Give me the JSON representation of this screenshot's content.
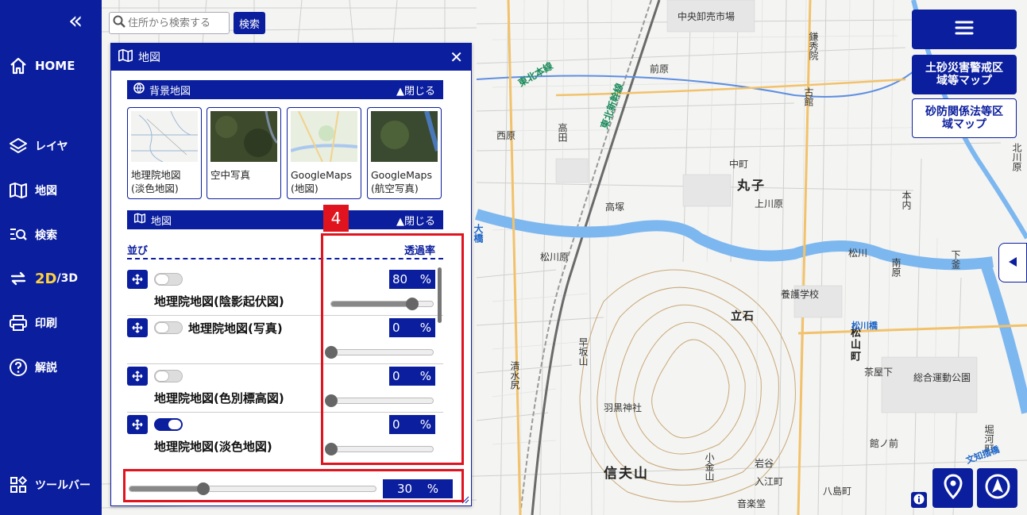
{
  "colors": {
    "primary": "#0b1e9e",
    "accent_2d": "#ffd23c",
    "highlight": "#e0141e"
  },
  "sidebar": {
    "collapse_icon": "double-chevron-left-icon",
    "items": [
      {
        "label": "HOME",
        "icon": "home-icon"
      },
      {
        "label": "レイヤ",
        "icon": "layers-icon"
      },
      {
        "label": "地図",
        "icon": "map-icon"
      },
      {
        "label": "検索",
        "icon": "search-list-icon"
      },
      {
        "label_2d": "2D",
        "label_3d": "/3D",
        "icon": "swap-icon"
      },
      {
        "label": "印刷",
        "icon": "printer-icon"
      },
      {
        "label": "解説",
        "icon": "help-icon"
      },
      {
        "label": "ツールバー",
        "icon": "grid-icon"
      }
    ]
  },
  "search": {
    "placeholder": "住所から検索する",
    "button": "検索"
  },
  "panel": {
    "title": "地図",
    "basemap_section": {
      "title": "背景地図",
      "toggle": "▲閉じる",
      "items": [
        {
          "name": "地理院地図\n(淡色地図)"
        },
        {
          "name": "空中写真"
        },
        {
          "name": "GoogleMaps\n(地図)"
        },
        {
          "name": "GoogleMaps\n(航空写真)"
        }
      ]
    },
    "map_section": {
      "title": "地図",
      "toggle": "▲閉じる",
      "col_order": "並び",
      "col_opacity": "透過率",
      "layers": [
        {
          "name": "地理院地図(陰影起伏図)",
          "enabled": false,
          "opacity": "80",
          "opacity_value": 80,
          "unit": "%"
        },
        {
          "name": "地理院地図(写真)",
          "enabled": false,
          "opacity": "0",
          "opacity_value": 0,
          "unit": "%"
        },
        {
          "name": "地理院地図(色別標高図)",
          "enabled": false,
          "opacity": "0",
          "opacity_value": 0,
          "unit": "%"
        },
        {
          "name": "地理院地図(淡色地図)",
          "enabled": true,
          "opacity": "0",
          "opacity_value": 0,
          "unit": "%"
        }
      ]
    },
    "overall_opacity": {
      "value": "30",
      "value_num": 30,
      "unit": "%"
    }
  },
  "annotation_badge": "4",
  "right_panel": {
    "menu_icon": "hamburger-icon",
    "btn_landslide": "土砂災害警戒区\n域等マップ",
    "btn_sabo": "砂防関係法等区\n域マップ",
    "side_tab_icon": "triangle-left-icon",
    "info_icon": "info-icon",
    "location_icon": "location-pin-icon",
    "compass_icon": "north-arrow-icon"
  },
  "map_labels": [
    "中央卸売市場",
    "鎌秀院",
    "古館",
    "前原",
    "高田",
    "東北本線",
    "東北新幹線",
    "西原",
    "中町",
    "丸子",
    "上川原",
    "高塚",
    "松川原",
    "大橋",
    "養護学校",
    "立石",
    "松山町",
    "茶屋下",
    "総合運動公園",
    "羽黒神社",
    "信夫山",
    "岩谷",
    "小金山",
    "入江町",
    "八島町",
    "音楽堂",
    "早坂山",
    "清水尻",
    "本内",
    "南原",
    "下釜",
    "北川原",
    "松川",
    "館ノ前",
    "堀河町",
    "文知摺橋",
    "松川橋"
  ]
}
